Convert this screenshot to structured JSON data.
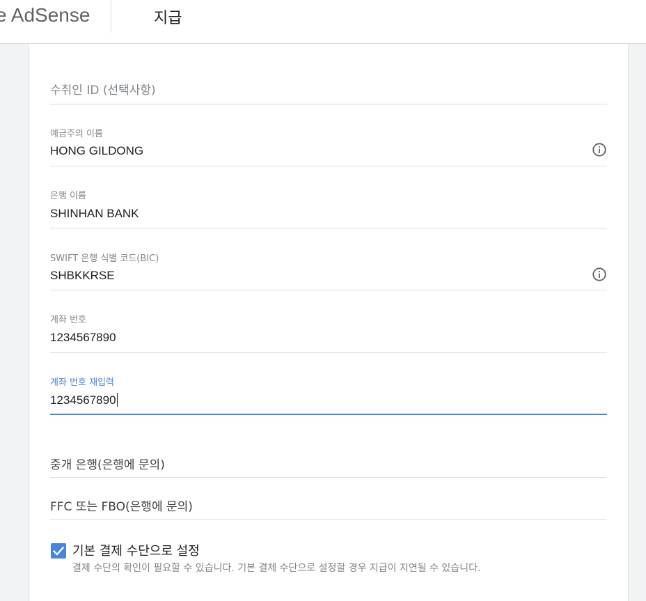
{
  "header": {
    "brand": "e AdSense",
    "title": "지급"
  },
  "form": {
    "payee_id": {
      "placeholder": "수취인 ID (선택사항)"
    },
    "account_holder": {
      "label": "예금주의 이름",
      "value": "HONG GILDONG",
      "icon": "info-icon"
    },
    "bank_name": {
      "label": "은행 이름",
      "value": "SHINHAN BANK"
    },
    "swift": {
      "label": "SWIFT 은행 식별 코드(BIC)",
      "value": "SHBKKRSE",
      "icon": "info-icon"
    },
    "account_number": {
      "label": "계좌 번호",
      "value": "1234567890"
    },
    "account_number_confirm": {
      "label": "계좌 번호 재입력",
      "value": "1234567890"
    },
    "intermediary_bank": {
      "label": "중개 은행(은행에 문의)"
    },
    "ffc_fbo": {
      "label": "FFC 또는 FBO(은행에 문의)"
    },
    "default_payment": {
      "checked": true,
      "label": "기본 결제 수단으로 설정",
      "description": "결제 수단의 확인이 필요할 수 있습니다. 기본 결제 수단으로 설정할 경우 지급이 지연될 수 있습니다."
    }
  },
  "colors": {
    "accent": "#4a86d8",
    "divider": "#dadce0",
    "muted_text": "#80868b",
    "text": "#202124"
  }
}
